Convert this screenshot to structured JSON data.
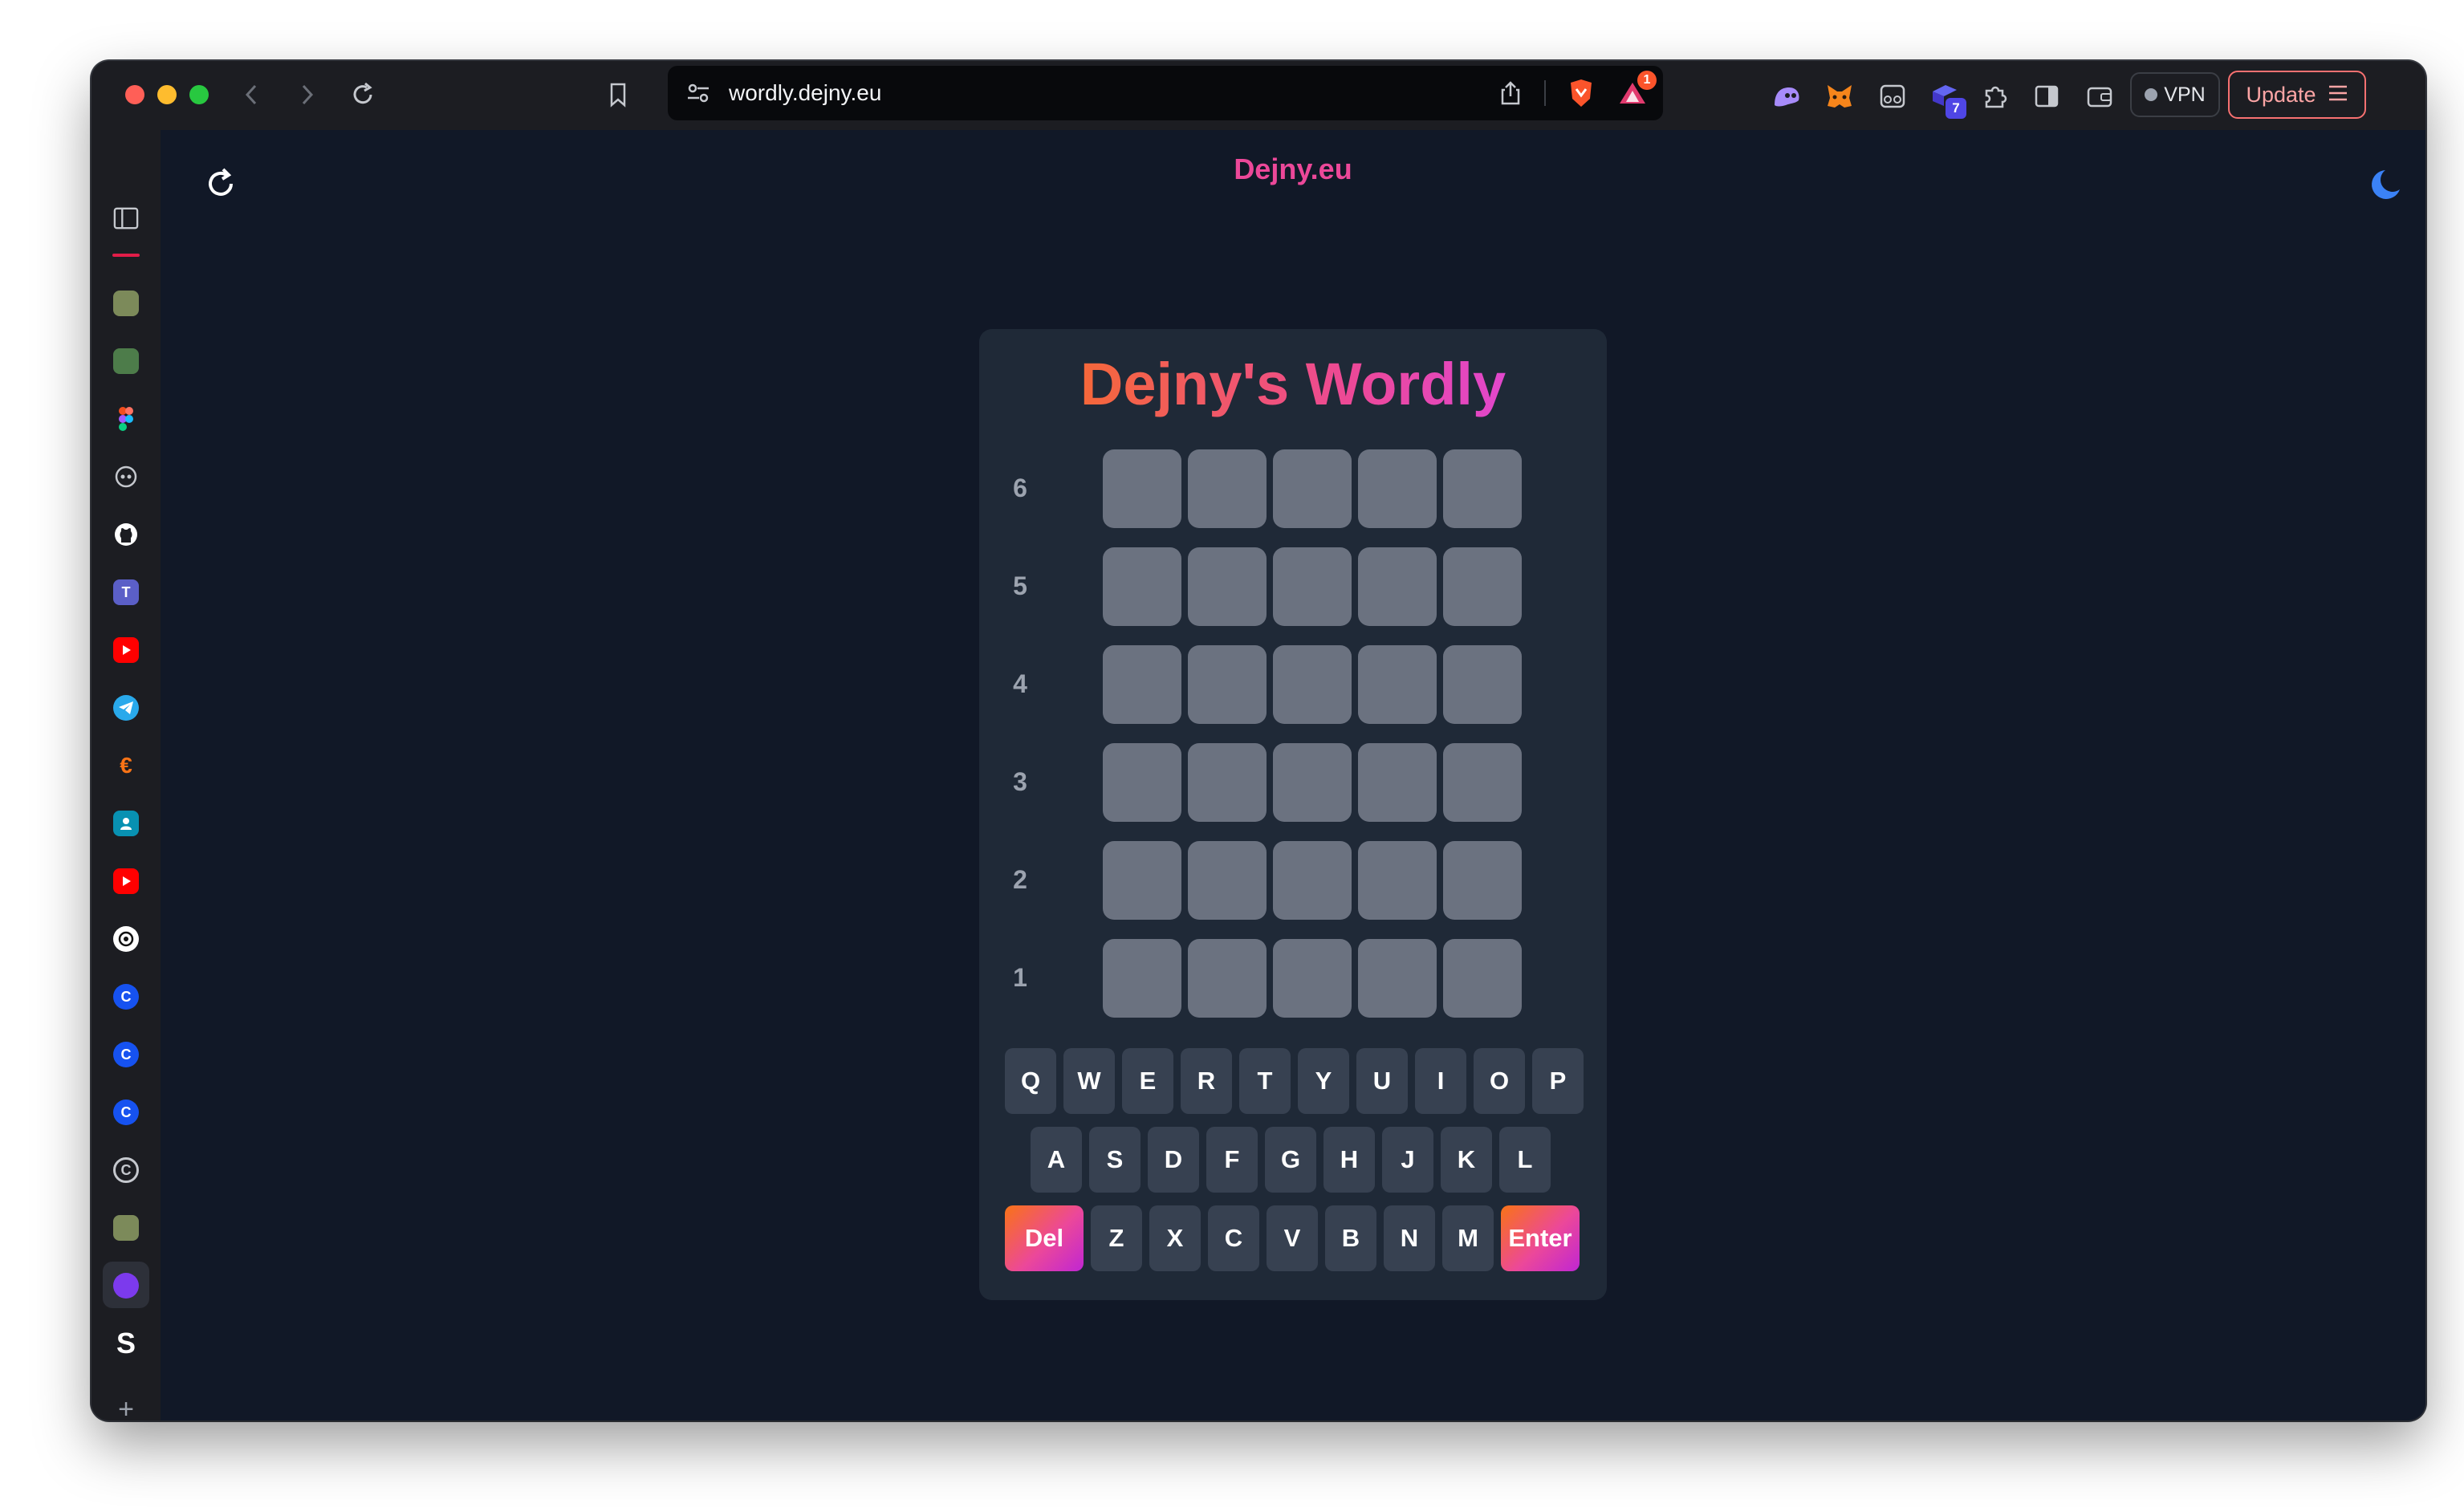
{
  "browser": {
    "url": "wordly.dejny.eu",
    "notification_count": "1",
    "extension_badge": "7",
    "vpn_label": "VPN",
    "update_label": "Update"
  },
  "site": {
    "title": "Dejny.eu"
  },
  "game": {
    "title": "Dejny's Wordly",
    "row_numbers": [
      "6",
      "5",
      "4",
      "3",
      "2",
      "1"
    ],
    "keyboard": {
      "row1": [
        "Q",
        "W",
        "E",
        "R",
        "T",
        "Y",
        "U",
        "I",
        "O",
        "P"
      ],
      "row2": [
        "A",
        "S",
        "D",
        "F",
        "G",
        "H",
        "J",
        "K",
        "L"
      ],
      "row3": [
        "Del",
        "Z",
        "X",
        "C",
        "V",
        "B",
        "N",
        "M",
        "Enter"
      ]
    }
  },
  "colors": {
    "accent": "#ec4899",
    "tile": "#6b7280",
    "key": "#374151",
    "background": "#111827",
    "card": "#1f2937"
  }
}
